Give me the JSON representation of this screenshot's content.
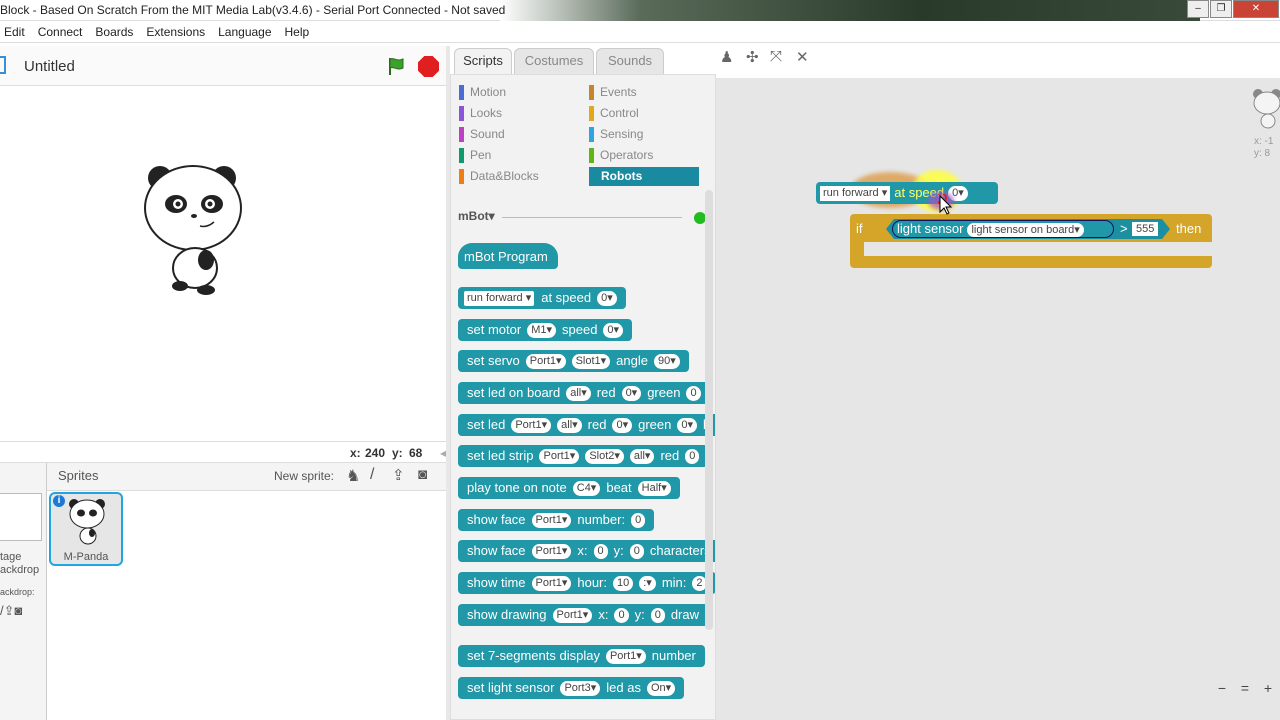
{
  "window": {
    "title": "Block - Based On Scratch From the MIT Media Lab(v3.4.6) - Serial Port Connected - Not saved",
    "minimize": "–",
    "maximize": "❐",
    "close": "✕"
  },
  "menu": [
    "Edit",
    "Connect",
    "Boards",
    "Extensions",
    "Language",
    "Help"
  ],
  "stage": {
    "project_title": "Untitled",
    "x_label": "x:",
    "x_value": "240",
    "y_label": "y:",
    "y_value": "68"
  },
  "sprites_panel": {
    "title": "Sprites",
    "new_sprite_label": "New sprite:",
    "stage_label_1": "tage",
    "stage_label_2": "ackdrop",
    "backdrop_label": "ackdrop:",
    "selected_sprite": "M-Panda"
  },
  "tabs": [
    "Scripts",
    "Costumes",
    "Sounds"
  ],
  "categories_left": [
    "Motion",
    "Looks",
    "Sound",
    "Pen",
    "Data&Blocks"
  ],
  "categories_right": [
    "Events",
    "Control",
    "Sensing",
    "Operators",
    "Robots"
  ],
  "category_colors": {
    "Motion": "#4a6cd4",
    "Looks": "#8a55d7",
    "Sound": "#bb42c3",
    "Pen": "#0e9a6c",
    "Data&Blocks": "#ee7d16",
    "Events": "#c88330",
    "Control": "#e1a91a",
    "Sensing": "#2ca5e2",
    "Operators": "#5cb712",
    "Robots": "#1a8aa0"
  },
  "palette": {
    "device_label": "mBot▾",
    "hat_block": "mBot Program",
    "blocks": [
      {
        "parts": [
          [
            "dd",
            "run forward ▾"
          ],
          [
            "t",
            "at speed"
          ],
          [
            "in",
            "0▾"
          ]
        ]
      },
      {
        "parts": [
          [
            "t",
            "set motor"
          ],
          [
            "in",
            "M1▾"
          ],
          [
            "t",
            "speed"
          ],
          [
            "in",
            "0▾"
          ]
        ]
      },
      {
        "parts": [
          [
            "t",
            "set servo"
          ],
          [
            "in",
            "Port1▾"
          ],
          [
            "in",
            "Slot1▾"
          ],
          [
            "t",
            "angle"
          ],
          [
            "in",
            "90▾"
          ]
        ]
      },
      {
        "parts": [
          [
            "t",
            "set led on board"
          ],
          [
            "in",
            "all▾"
          ],
          [
            "t",
            "red"
          ],
          [
            "in",
            "0▾"
          ],
          [
            "t",
            "green"
          ],
          [
            "in",
            "0"
          ]
        ]
      },
      {
        "parts": [
          [
            "t",
            "set led"
          ],
          [
            "in",
            "Port1▾"
          ],
          [
            "in",
            "all▾"
          ],
          [
            "t",
            "red"
          ],
          [
            "in",
            "0▾"
          ],
          [
            "t",
            "green"
          ],
          [
            "in",
            "0▾"
          ],
          [
            "t",
            "b"
          ]
        ]
      },
      {
        "parts": [
          [
            "t",
            "set led strip"
          ],
          [
            "in",
            "Port1▾"
          ],
          [
            "in",
            "Slot2▾"
          ],
          [
            "in",
            "all▾"
          ],
          [
            "t",
            "red"
          ],
          [
            "in",
            "0"
          ]
        ]
      },
      {
        "parts": [
          [
            "t",
            "play tone on note"
          ],
          [
            "in",
            "C4▾"
          ],
          [
            "t",
            "beat"
          ],
          [
            "in",
            "Half▾"
          ]
        ]
      },
      {
        "parts": [
          [
            "t",
            "show face"
          ],
          [
            "in",
            "Port1▾"
          ],
          [
            "t",
            "number:"
          ],
          [
            "in",
            "0"
          ]
        ]
      },
      {
        "parts": [
          [
            "t",
            "show face"
          ],
          [
            "in",
            "Port1▾"
          ],
          [
            "t",
            "x:"
          ],
          [
            "in",
            "0"
          ],
          [
            "t",
            "y:"
          ],
          [
            "in",
            "0"
          ],
          [
            "t",
            "characters"
          ]
        ]
      },
      {
        "parts": [
          [
            "t",
            "show time"
          ],
          [
            "in",
            "Port1▾"
          ],
          [
            "t",
            "hour:"
          ],
          [
            "in",
            "10"
          ],
          [
            "in",
            ":▾"
          ],
          [
            "t",
            "min:"
          ],
          [
            "in",
            "2"
          ]
        ]
      },
      {
        "parts": [
          [
            "t",
            "show drawing"
          ],
          [
            "in",
            "Port1▾"
          ],
          [
            "t",
            "x:"
          ],
          [
            "in",
            "0"
          ],
          [
            "t",
            "y:"
          ],
          [
            "in",
            "0"
          ],
          [
            "t",
            "draw"
          ]
        ]
      },
      {
        "parts": [
          [
            "t",
            "set 7-segments display"
          ],
          [
            "in",
            "Port1▾"
          ],
          [
            "t",
            "number"
          ]
        ]
      },
      {
        "parts": [
          [
            "t",
            "set light sensor"
          ],
          [
            "in",
            "Port3▾"
          ],
          [
            "t",
            "led as"
          ],
          [
            "in",
            "On▾"
          ]
        ]
      }
    ]
  },
  "script": {
    "run_dropdown": "run forward ▾",
    "run_at": "at",
    "run_speed": "speed",
    "run_value": "0▾",
    "if_label": "if",
    "then_label": "then",
    "sensor_label": "light sensor",
    "sensor_dropdown": "light sensor on board▾",
    "operator": ">",
    "threshold": "555"
  },
  "mini_sprite": {
    "x": "x: -1",
    "y": "y: 8"
  },
  "zoom": [
    "−",
    "=",
    "+"
  ]
}
